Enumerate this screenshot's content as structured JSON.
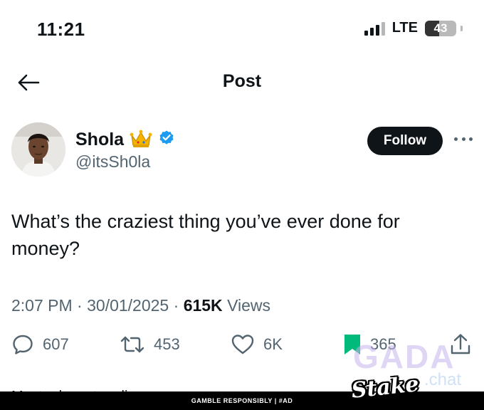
{
  "status_bar": {
    "time": "11:21",
    "network": "LTE",
    "battery": "43"
  },
  "header": {
    "title": "Post",
    "back_icon": "arrow-left-icon"
  },
  "author": {
    "display_name": "Shola",
    "handle": "@itsSh0la",
    "badge_emoji": "👑",
    "verified_color": "#1d9bf0",
    "follow_label": "Follow"
  },
  "tweet": {
    "text": "What’s the craziest thing you’ve ever done for money?",
    "time": "2:07 PM",
    "date": "30/01/2025",
    "views_count": "615K",
    "views_label": "Views"
  },
  "actions": {
    "replies": "607",
    "reposts": "453",
    "likes": "6K",
    "bookmarks": "365",
    "bookmark_color": "#00ba7c"
  },
  "watermark": {
    "brand": "GADA",
    "suffix": ".chat"
  },
  "cutoff_text": "Most relevant replies",
  "ad": {
    "disclaimer": "GAMBLE RESPONSIBLY  |  #AD",
    "brand": "Stake"
  },
  "colors": {
    "text": "#0f1419",
    "secondary": "#536471",
    "accent": "#1d9bf0",
    "bookmark": "#00ba7c"
  }
}
